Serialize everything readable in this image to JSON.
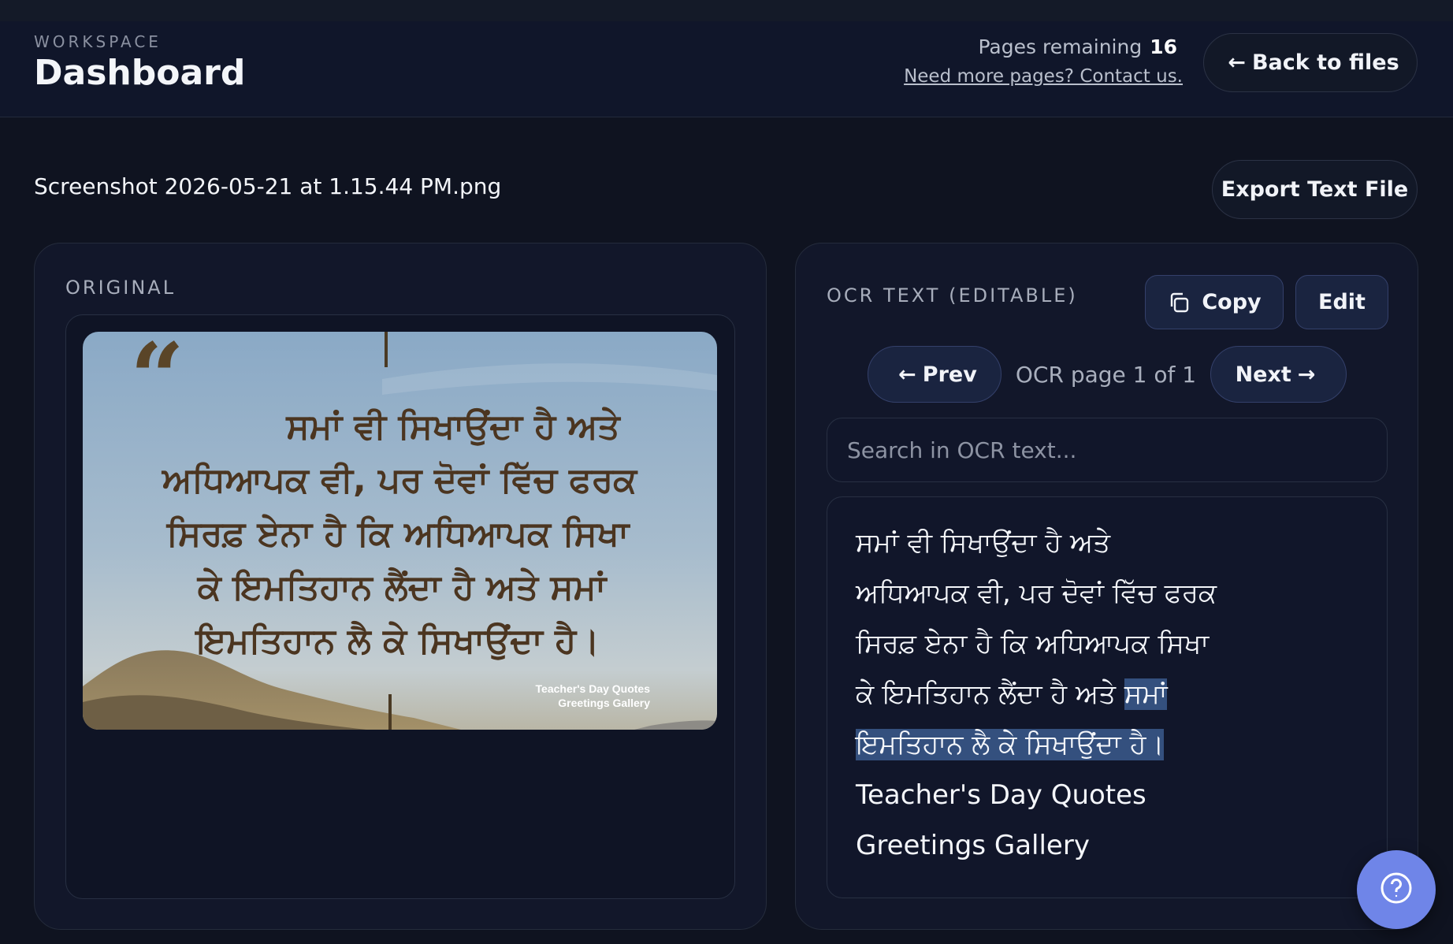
{
  "header": {
    "eyebrow": "WORKSPACE",
    "title": "Dashboard",
    "pages_remaining_label": "Pages remaining",
    "pages_remaining_count": "16",
    "contact_link": "Need more pages? Contact us.",
    "back_button": "Back to files"
  },
  "file": {
    "name": "Screenshot 2026-05-21 at 1.15.44 PM.png",
    "export_button": "Export Text File"
  },
  "original": {
    "label": "ORIGINAL",
    "image": {
      "lines": [
        "ਸਮਾਂ ਵੀ ਸਿਖਾਉਂਦਾ ਹੈ ਅਤੇ",
        "ਅਧਿਆਪਕ ਵੀ, ਪਰ ਦੋਵਾਂ ਵਿੱਚ ਫਰਕ",
        "ਸਿਰਫ਼ ਏਨਾ ਹੈ ਕਿ ਅਧਿਆਪਕ ਸਿਖਾ",
        "ਕੇ ਇਮਤਿਹਾਨ ਲੈਂਦਾ ਹੈ ਅਤੇ ਸਮਾਂ",
        "ਇਮਤਿਹਾਨ ਲੈ ਕੇ ਸਿਖਾਉਂਦਾ ਹੈ।"
      ],
      "watermark_line1": "Teacher's Day Quotes",
      "watermark_line2": "Greetings Gallery"
    }
  },
  "ocr": {
    "label": "OCR TEXT (EDITABLE)",
    "copy_button": "Copy",
    "edit_button": "Edit",
    "prev_button": "Prev",
    "next_button": "Next",
    "page_indicator": "OCR page 1 of 1",
    "search_placeholder": "Search in OCR text...",
    "lines": [
      "ਸਮਾਂ ਵੀ ਸਿਖਾਉਂਦਾ ਹੈ ਅਤੇ",
      "ਅਧਿਆਪਕ ਵੀ, ਪਰ ਦੋਵਾਂ ਵਿੱਚ ਫਰਕ",
      "ਸਿਰਫ਼ ਏਨਾ ਹੈ ਕਿ ਅਧਿਆਪਕ ਸਿਖਾ",
      "ਕੇ ਇਮਤਿਹਾਨ ਲੈਂਦਾ ਹੈ ਅਤੇ ",
      "ਸਮਾਂ",
      "ਇਮਤਿਹਾਨ ਲੈ ਕੇ ਸਿਖਾਉਂਦਾ ਹੈ।",
      "Teacher's Day Quotes",
      "Greetings Gallery"
    ]
  },
  "icons": {
    "back": "arrow-left-icon",
    "copy": "copy-icon",
    "prev": "arrow-left-icon",
    "next": "arrow-right-icon",
    "help": "question-circle-icon"
  },
  "colors": {
    "background": "#0f1320",
    "accent": "#6f85e8",
    "highlight": "#34507e"
  }
}
